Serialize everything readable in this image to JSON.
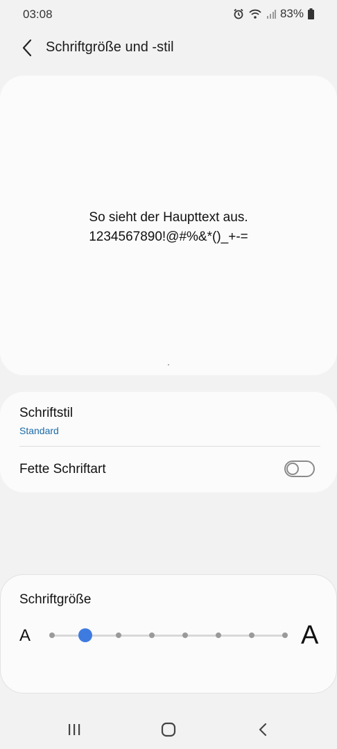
{
  "status_bar": {
    "time": "03:08",
    "battery": "83%",
    "icons": [
      "alarm-icon",
      "wifi-icon",
      "signal-icon",
      "battery-icon"
    ]
  },
  "header": {
    "title": "Schriftgröße und -stil",
    "back_icon": "back-arrow-icon"
  },
  "preview": {
    "line1": "So sieht der Haupttext aus.",
    "line2": "1234567890!@#%&*()_+-="
  },
  "settings": {
    "font_style_label": "Schriftstil",
    "font_style_value": "Standard",
    "bold_label": "Fette Schriftart",
    "bold_enabled": false
  },
  "font_size": {
    "label": "Schriftgröße",
    "small_glyph": "A",
    "large_glyph": "A",
    "steps": 8,
    "selected_step": 1
  },
  "navigation": {
    "icons": [
      "recents-icon",
      "home-icon",
      "back-icon"
    ]
  },
  "colors": {
    "accent": "#3e7be0",
    "link": "#1b6aa8",
    "background": "#f2f2f2",
    "card": "#fbfbfb"
  }
}
